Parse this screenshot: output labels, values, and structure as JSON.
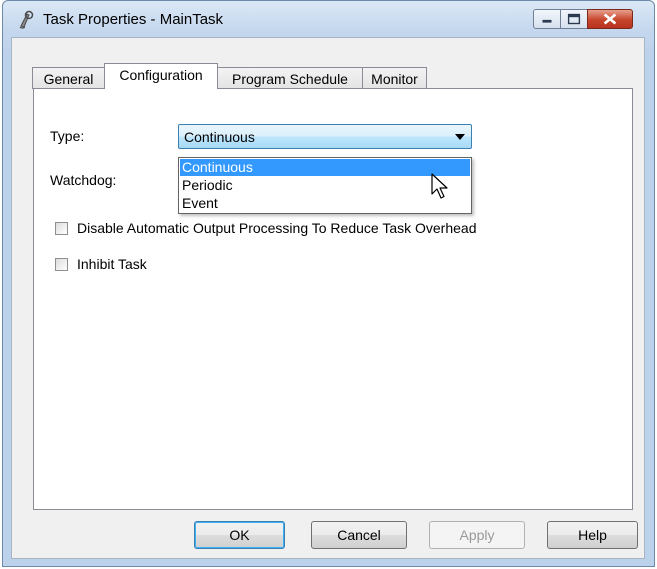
{
  "window": {
    "title": "Task Properties - MainTask",
    "controls": [
      "minimize-icon",
      "maximize-icon",
      "close-icon"
    ]
  },
  "tabs": [
    {
      "label": "General",
      "active": false
    },
    {
      "label": "Configuration",
      "active": true
    },
    {
      "label": "Program Schedule",
      "active": false
    },
    {
      "label": "Monitor",
      "active": false
    }
  ],
  "config": {
    "type_label": "Type:",
    "type_value": "Continuous",
    "watchdog_label": "Watchdog:",
    "type_options": [
      "Continuous",
      "Periodic",
      "Event"
    ],
    "selected_option": "Continuous",
    "disable_output_label": "Disable Automatic Output Processing To Reduce Task Overhead",
    "disable_output_checked": false,
    "inhibit_label": "Inhibit Task",
    "inhibit_checked": false
  },
  "buttons": {
    "ok": "OK",
    "cancel": "Cancel",
    "apply": "Apply",
    "help": "Help"
  },
  "colors": {
    "selection": "#3399ff",
    "close_button": "#c7452c"
  }
}
